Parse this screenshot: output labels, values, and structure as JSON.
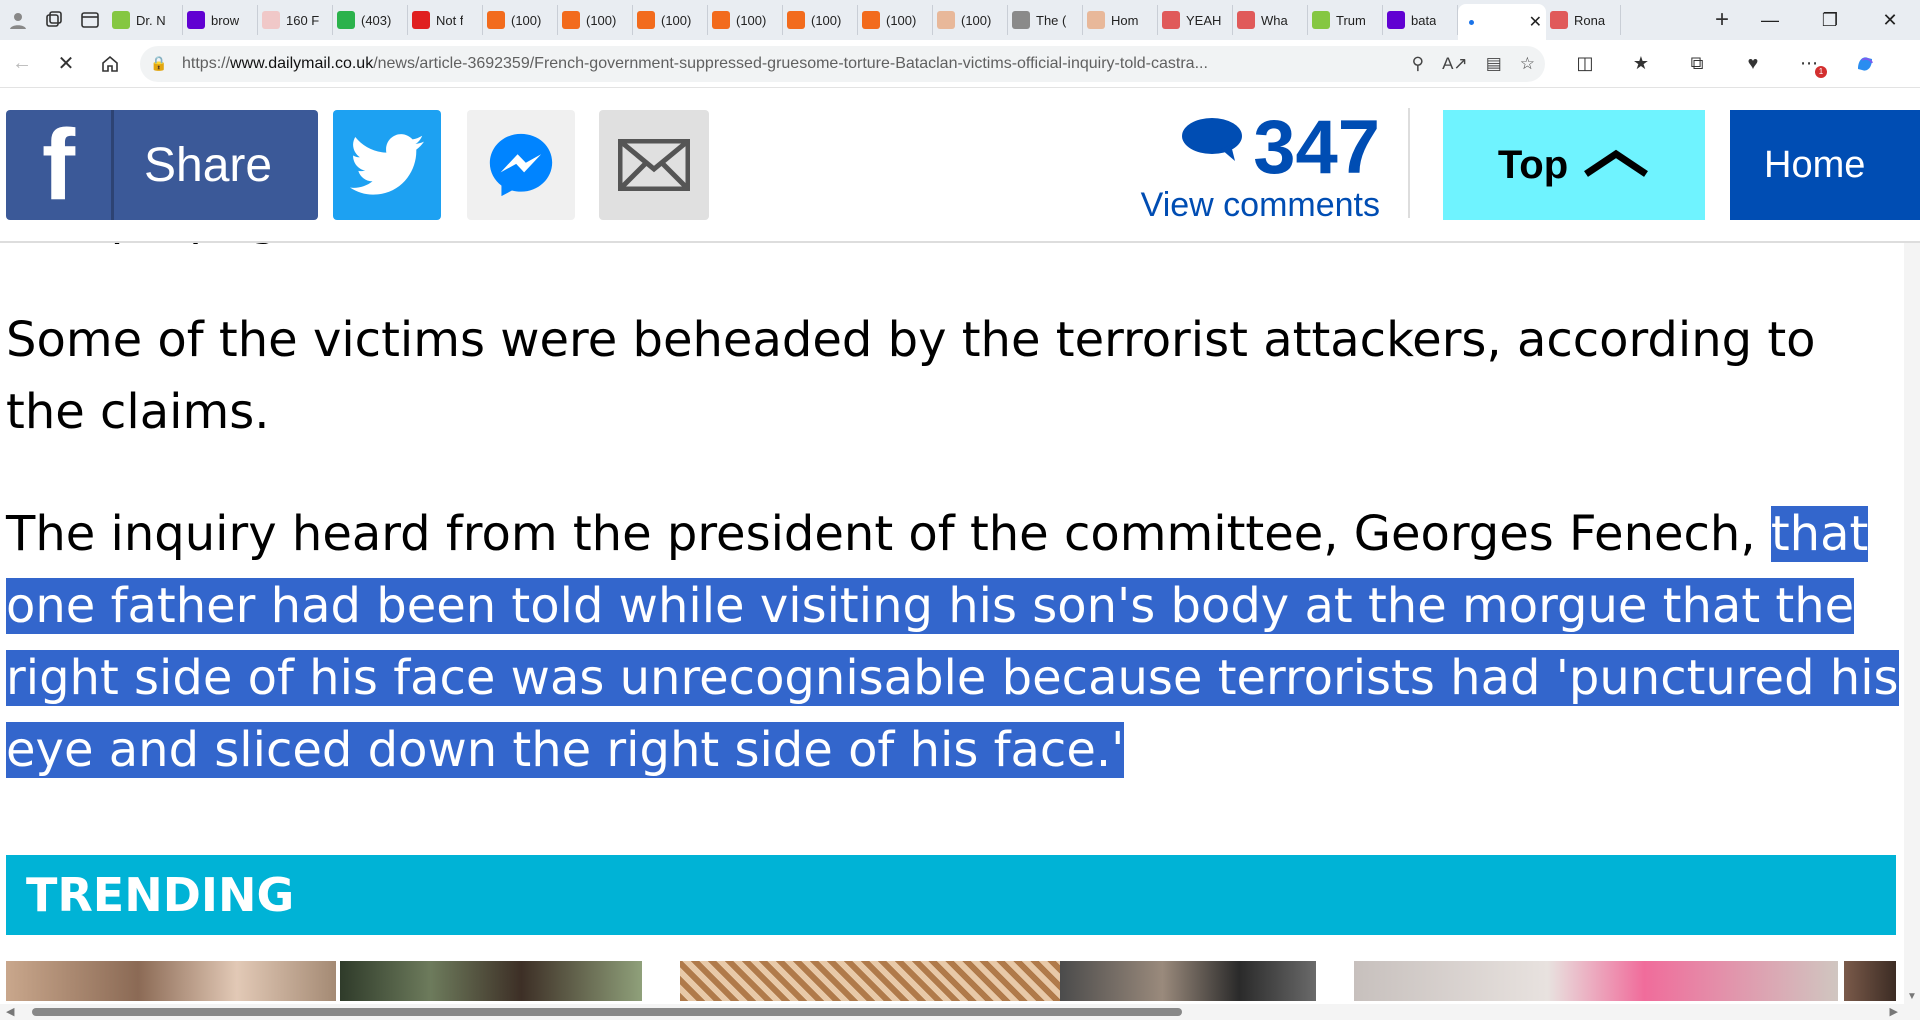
{
  "browser": {
    "tabs": [
      {
        "label": "Dr. N",
        "icon": "rumble-icon",
        "color": "#85c742"
      },
      {
        "label": "brow",
        "icon": "yahoo-icon",
        "color": "#6001d2"
      },
      {
        "label": "160 F",
        "icon": "bi-icon",
        "color": "#f0c8c8"
      },
      {
        "label": "(403)",
        "icon": "green-g-icon",
        "color": "#2bb24c"
      },
      {
        "label": "Not f",
        "icon": "red-badge-icon",
        "color": "#e02020"
      },
      {
        "label": "(100)",
        "icon": "bookmark-orange-icon",
        "color": "#f26b1d"
      },
      {
        "label": "(100)",
        "icon": "bookmark-orange-icon",
        "color": "#f26b1d"
      },
      {
        "label": "(100)",
        "icon": "bookmark-orange-icon",
        "color": "#f26b1d"
      },
      {
        "label": "(100)",
        "icon": "bookmark-orange-icon",
        "color": "#f26b1d"
      },
      {
        "label": "(100)",
        "icon": "bookmark-orange-icon",
        "color": "#f26b1d"
      },
      {
        "label": "(100)",
        "icon": "bookmark-orange-icon",
        "color": "#f26b1d"
      },
      {
        "label": "(100)",
        "icon": "bookmark-tan-icon",
        "color": "#e8b89a"
      },
      {
        "label": "The (",
        "icon": "ds-icon",
        "color": "#8a8a8a"
      },
      {
        "label": "Hom",
        "icon": "bookmark-tan-icon",
        "color": "#e8b89a"
      },
      {
        "label": "YEAH",
        "icon": "youtube-icon",
        "color": "#e05a5a"
      },
      {
        "label": "Wha",
        "icon": "youtube-icon",
        "color": "#e05a5a"
      },
      {
        "label": "Trum",
        "icon": "rumble-icon",
        "color": "#85c742"
      },
      {
        "label": "bata",
        "icon": "yahoo-icon",
        "color": "#6001d2"
      },
      {
        "label": "",
        "icon": "loading-dot-icon",
        "color": "#1a73e8",
        "active": true
      },
      {
        "label": "Rona",
        "icon": "youtube-icon",
        "color": "#e05a5a"
      }
    ],
    "url_prefix": "https://",
    "url_host": "www.dailymail.co.uk",
    "url_path": "/news/article-3692359/French-government-suppressed-gruesome-torture-Bataclan-victims-official-inquiry-told-castra...",
    "notification_count": "1"
  },
  "share": {
    "facebook_letter": "f",
    "facebook_label": "Share"
  },
  "comments": {
    "count": "347",
    "label": "View comments"
  },
  "top_button": "Top",
  "home_button": "Home",
  "article": {
    "para_prev": "ISIS propoganda, it was claimed.",
    "para1": "Some of the victims were beheaded by the terrorist attackers, according to the claims.",
    "para2_plain": "The inquiry heard from the president of the committee, Georges Fenech,  ",
    "para2_selected": "that one father had been told while visiting his son's body at the morgue that the right side of his face was unrecognisable because terrorists had 'punctured his eye and sliced down the right side of his face.'"
  },
  "trending": {
    "title": "TRENDING"
  },
  "colors": {
    "dm_blue": "#004db3",
    "selection": "#3366cc",
    "trending_bg": "#00b3d6",
    "top_bg": "#6ff3ff",
    "facebook": "#3b5998",
    "twitter": "#1da1f2"
  }
}
